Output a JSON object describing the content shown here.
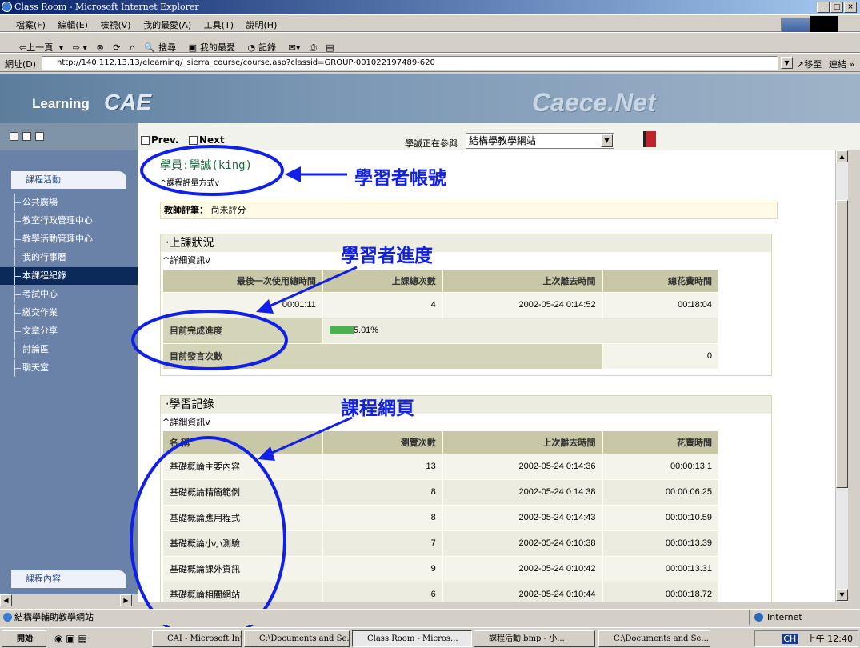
{
  "window": {
    "title": "Class Room - Microsoft Internet Explorer"
  },
  "menu": [
    "檔案(F)",
    "編輯(E)",
    "檢視(V)",
    "我的最愛(A)",
    "工具(T)",
    "說明(H)"
  ],
  "toolbar": {
    "back": "⇦上一頁",
    "search": "搜尋",
    "favorites": "我的最愛",
    "history": "記錄"
  },
  "address": {
    "label": "網址(D)",
    "url": "http://140.112.13.13/elearning/_sierra_course/course.asp?classid=GROUP-001022197489-620",
    "go": "移至",
    "links": "連結"
  },
  "banner": {
    "learning": "Learning",
    "cae": "CAE",
    "caece": "Caece.Net"
  },
  "nav": {
    "prev": "Prev.",
    "next": "Next",
    "participating_label": "學誠正在參與",
    "site_select": "結構學教學網站"
  },
  "sidebar": {
    "header": "課程活動",
    "items": [
      "公共廣場",
      "教室行政管理中心",
      "教學活動管理中心",
      "我的行事曆",
      "本課程紀錄",
      "考試中心",
      "繳交作業",
      "文章分享",
      "討論區",
      "聊天室"
    ],
    "active_index": 4,
    "footer_header": "課程內容"
  },
  "student": {
    "name_line": "學員:學誠(king)",
    "grading_method": "^課程評量方式v"
  },
  "teacher_comment": {
    "label": "教師評筆：",
    "value": "尚未評分"
  },
  "attendance": {
    "title": "‧上課狀況",
    "detail": "^詳細資訊v",
    "headers": [
      "最後一次使用總時間",
      "上課總次數",
      "上次離去時間",
      "總花費時間"
    ],
    "values": [
      "00:01:11",
      "4",
      "2002-05-24 0:14:52",
      "00:18:04"
    ],
    "progress_label": "目前完成進度",
    "progress_text": "5.01%",
    "progress_value": 5.01,
    "posts_label": "目前發言次數",
    "posts_value": "0"
  },
  "records": {
    "title": "‧學習記錄",
    "detail": "^詳細資訊v",
    "headers": [
      "名 稱",
      "瀏覽次數",
      "上次離去時間",
      "花費時間"
    ],
    "rows": [
      [
        "基礎概論主要內容",
        "13",
        "2002-05-24 0:14:36",
        "00:00:13.1"
      ],
      [
        "基礎概論精簡範例",
        "8",
        "2002-05-24 0:14:38",
        "00:00:06.25"
      ],
      [
        "基礎概論應用程式",
        "8",
        "2002-05-24 0:14:43",
        "00:00:10.59"
      ],
      [
        "基礎概論小小測驗",
        "7",
        "2002-05-24 0:10:38",
        "00:00:13.39"
      ],
      [
        "基礎概論課外資訊",
        "9",
        "2002-05-24 0:10:42",
        "00:00:13.31"
      ],
      [
        "基礎概論相關網站",
        "6",
        "2002-05-24 0:10:44",
        "00:00:18.72"
      ]
    ]
  },
  "annotations": {
    "account": "學習者帳號",
    "progress": "學習者進度",
    "pages": "課程網頁"
  },
  "statusbar": {
    "text": "結構學輔助教學網站",
    "zone": "Internet"
  },
  "taskbar": {
    "start": "開始",
    "tasks": [
      "CAI - Microsoft Inter...",
      "C:\\Documents and Se...",
      "Class Room - Micros...",
      "課程活動.bmp - 小...",
      "C:\\Documents and Se..."
    ],
    "clock": "上午 12:40",
    "lang": "CH"
  },
  "colors": {
    "sidebar": "#6b82a8",
    "annotation": "#1020e8",
    "table_header": "#c8c8a8",
    "progress_bar": "#4caf50"
  }
}
